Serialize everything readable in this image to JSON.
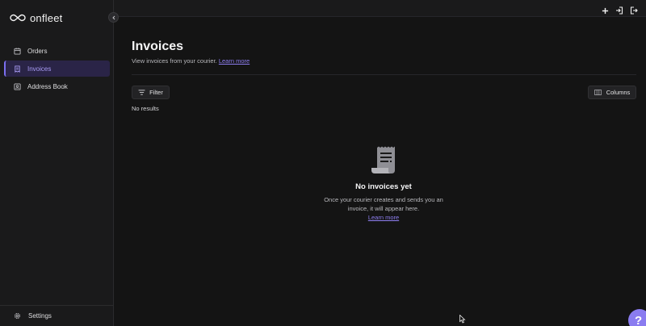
{
  "app": {
    "logo_text": "onfleet"
  },
  "sidebar": {
    "items": [
      {
        "label": "Orders",
        "icon": "calendar-icon",
        "active": false
      },
      {
        "label": "Invoices",
        "icon": "receipt-icon",
        "active": true
      },
      {
        "label": "Address Book",
        "icon": "contact-book-icon",
        "active": false
      }
    ],
    "settings_label": "Settings"
  },
  "topbar": {
    "icons": [
      "plus-icon",
      "login-icon",
      "logout-icon"
    ]
  },
  "page": {
    "title": "Invoices",
    "subtitle": "View invoices from your courier.",
    "subtitle_link": "Learn more",
    "filter_label": "Filter",
    "columns_label": "Columns",
    "no_results": "No results"
  },
  "empty_state": {
    "icon": "receipt-icon",
    "title": "No invoices yet",
    "description": "Once your courier creates and sends you an invoice, it will appear here.",
    "link": "Learn more"
  },
  "help": {
    "label": "?"
  },
  "colors": {
    "accent": "#8f7ff2",
    "background": "#141414",
    "sidebar": "#1a1a1b"
  }
}
